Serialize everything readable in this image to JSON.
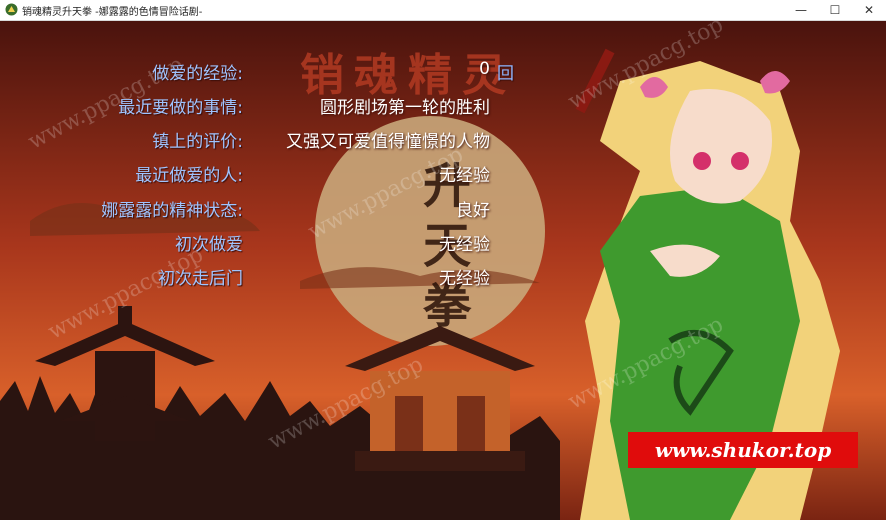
{
  "window": {
    "title": "销魂精灵升天拳 -娜露露的色情冒险话剧-",
    "controls": {
      "minimize": "—",
      "maximize": "☐",
      "close": "✕"
    }
  },
  "logo": {
    "line1": "销魂精灵",
    "line2": "升",
    "line3": "天",
    "line4": "拳"
  },
  "stats": [
    {
      "label": "做爱的经验:",
      "value": "0"
    },
    {
      "label": "最近要做的事情:",
      "value": "圆形剧场第一轮的胜利"
    },
    {
      "label": "镇上的评价:",
      "value": "又强又可爱值得憧憬的人物"
    },
    {
      "label": "最近做爱的人:",
      "value": "无经验"
    },
    {
      "label": "娜露露的精神状态:",
      "value": "良好"
    },
    {
      "label": "初次做爱",
      "value": "无经验"
    },
    {
      "label": "初次走后门",
      "value": "无经验"
    }
  ],
  "count_unit": "回",
  "watermark": "www.ppacg.top",
  "banner": "www.shukor.top",
  "colors": {
    "accent_label": "#9fc4ff",
    "value_text": "#ffffff",
    "banner": "#e00c0c",
    "sky_top": "#5a1a10",
    "sky_bottom": "#d8602a"
  },
  "icons": {
    "app": "app-icon",
    "minimize": "minimize-icon",
    "maximize": "maximize-icon",
    "close": "close-icon"
  }
}
